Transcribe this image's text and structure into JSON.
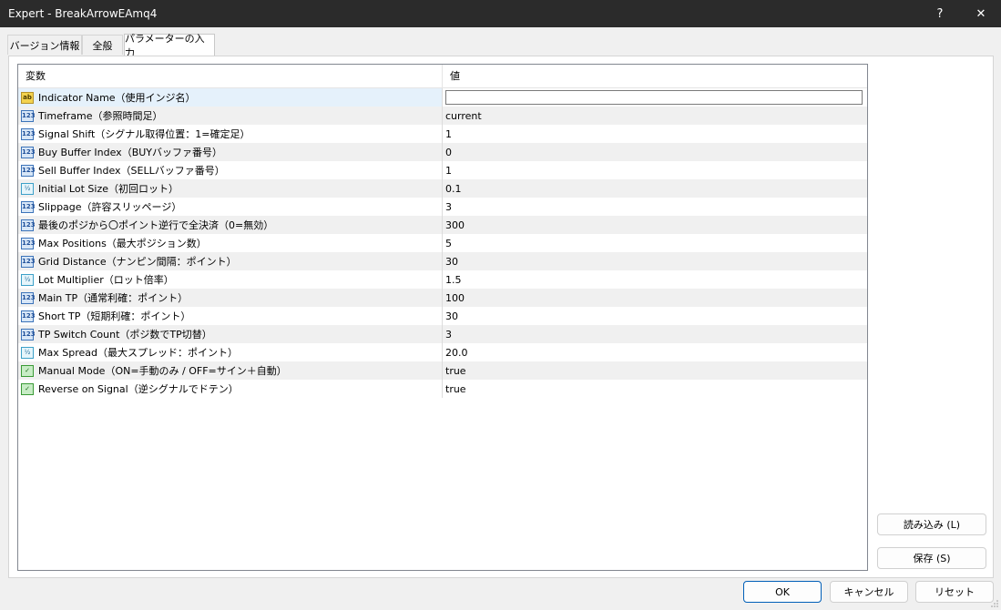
{
  "window": {
    "title": "Expert - BreakArrowEAmq4",
    "help_label": "?",
    "close_label": "✕"
  },
  "tabs": [
    {
      "label": "バージョン情報"
    },
    {
      "label": "全般"
    },
    {
      "label": "パラメーターの入力",
      "active": true
    }
  ],
  "grid": {
    "col_variable": "変数",
    "col_value": "値",
    "rows": [
      {
        "icon": "string-icon",
        "badge": "ab",
        "name": "Indicator Name（使用インジ名）",
        "value": ""
      },
      {
        "icon": "integer-icon",
        "badge": "123",
        "name": "Timeframe（参照時間足）",
        "value": "current"
      },
      {
        "icon": "integer-icon",
        "badge": "123",
        "name": "Signal Shift（シグナル取得位置：1=確定足）",
        "value": "1"
      },
      {
        "icon": "integer-icon",
        "badge": "123",
        "name": "Buy Buffer Index（BUYバッファ番号）",
        "value": "0"
      },
      {
        "icon": "integer-icon",
        "badge": "123",
        "name": "Sell Buffer Index（SELLバッファ番号）",
        "value": "1"
      },
      {
        "icon": "double-icon",
        "badge": "½",
        "name": "Initial Lot Size（初回ロット）",
        "value": "0.1"
      },
      {
        "icon": "integer-icon",
        "badge": "123",
        "name": "Slippage（許容スリッページ）",
        "value": "3"
      },
      {
        "icon": "integer-icon",
        "badge": "123",
        "name": "最後のポジから〇ポイント逆行で全決済（0=無効）",
        "value": "300"
      },
      {
        "icon": "integer-icon",
        "badge": "123",
        "name": "Max Positions（最大ポジション数）",
        "value": "5"
      },
      {
        "icon": "integer-icon",
        "badge": "123",
        "name": "Grid Distance（ナンピン間隔：ポイント）",
        "value": "30"
      },
      {
        "icon": "double-icon",
        "badge": "½",
        "name": "Lot Multiplier（ロット倍率）",
        "value": "1.5"
      },
      {
        "icon": "integer-icon",
        "badge": "123",
        "name": "Main TP（通常利確：ポイント）",
        "value": "100"
      },
      {
        "icon": "integer-icon",
        "badge": "123",
        "name": "Short TP（短期利確：ポイント）",
        "value": "30"
      },
      {
        "icon": "integer-icon",
        "badge": "123",
        "name": "TP Switch Count（ポジ数でTP切替）",
        "value": "3"
      },
      {
        "icon": "double-icon",
        "badge": "½",
        "name": "Max Spread（最大スプレッド：ポイント）",
        "value": "20.0"
      },
      {
        "icon": "bool-icon",
        "badge": "✓",
        "name": "Manual Mode（ON=手動のみ / OFF=サイン＋自動）",
        "value": "true"
      },
      {
        "icon": "bool-icon",
        "badge": "✓",
        "name": "Reverse on Signal（逆シグナルでドテン）",
        "value": "true"
      }
    ]
  },
  "side_buttons": {
    "load": "読み込み (L)",
    "save": "保存 (S)"
  },
  "footer_buttons": {
    "ok": "OK",
    "cancel": "キャンセル",
    "reset": "リセット"
  }
}
